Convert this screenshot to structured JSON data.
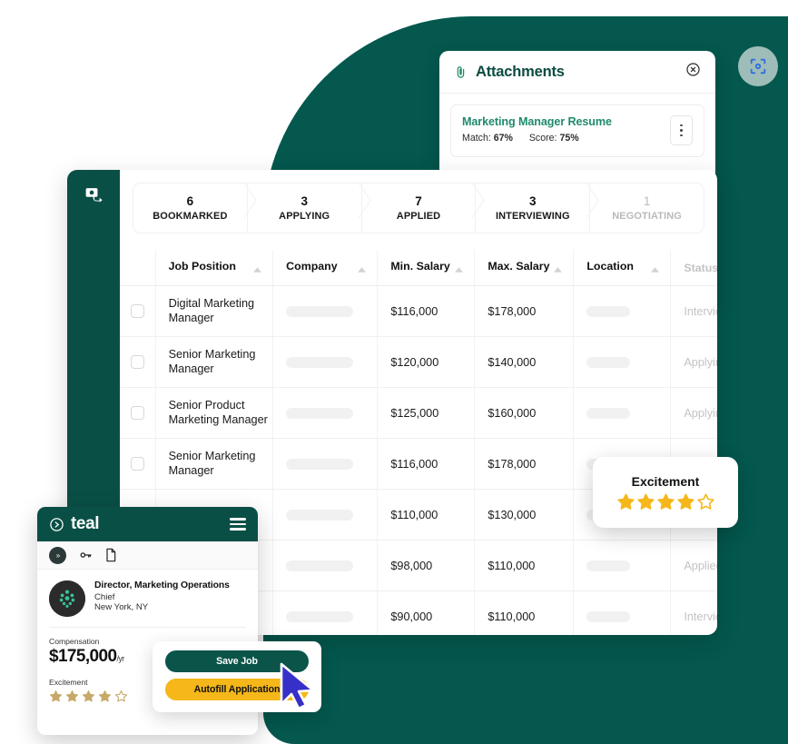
{
  "colors": {
    "teal_bg": "#04584e",
    "teal_dark": "#0a4f45",
    "brand_green": "#1f8a6d",
    "gold": "#f5b719",
    "cursor_blue": "#3730c8",
    "muted": "#c3c3c3"
  },
  "scan_button": {
    "icon": "scan-capture-icon"
  },
  "attachments": {
    "icon": "paperclip-icon",
    "title": "Attachments",
    "close_icon": "close-circle-icon",
    "items": [
      {
        "name": "Marketing Manager Resume",
        "match_label": "Match:",
        "match_value": "67%",
        "score_label": "Score:",
        "score_value": "75%",
        "menu_icon": "kebab-menu-icon"
      }
    ]
  },
  "tracker": {
    "logo_icon": "teal-logo-mark",
    "pipeline": [
      {
        "count": "6",
        "label": "BOOKMARKED",
        "muted": false
      },
      {
        "count": "3",
        "label": "APPLYING",
        "muted": false
      },
      {
        "count": "7",
        "label": "APPLIED",
        "muted": false
      },
      {
        "count": "3",
        "label": "INTERVIEWING",
        "muted": false
      },
      {
        "count": "1",
        "label": "NEGOTIATING",
        "muted": true
      }
    ],
    "columns": [
      {
        "label": "Job Position",
        "sortable": true,
        "muted": false
      },
      {
        "label": "Company",
        "sortable": true,
        "muted": false
      },
      {
        "label": "Min. Salary",
        "sortable": true,
        "muted": false
      },
      {
        "label": "Max. Salary",
        "sortable": true,
        "muted": false
      },
      {
        "label": "Location",
        "sortable": true,
        "muted": false
      },
      {
        "label": "Status",
        "sortable": false,
        "muted": true
      }
    ],
    "rows": [
      {
        "job": "Digital Marketing Manager",
        "company": "",
        "min": "$116,000",
        "max": "$178,000",
        "location": "",
        "status": "Intervie"
      },
      {
        "job": "Senior Marketing Manager",
        "company": "",
        "min": "$120,000",
        "max": "$140,000",
        "location": "",
        "status": "Applyin"
      },
      {
        "job": "Senior Product Marketing Manager",
        "company": "",
        "min": "$125,000",
        "max": "$160,000",
        "location": "",
        "status": "Applyin"
      },
      {
        "job": "Senior Marketing Manager",
        "company": "",
        "min": "$116,000",
        "max": "$178,000",
        "location": "",
        "status": ""
      },
      {
        "job": "",
        "company": "",
        "min": "$110,000",
        "max": "$130,000",
        "location": "",
        "status": ""
      },
      {
        "job": "",
        "company": "",
        "min": "$98,000",
        "max": "$110,000",
        "location": "",
        "status": "Applied"
      },
      {
        "job": "",
        "company": "",
        "min": "$90,000",
        "max": "$110,000",
        "location": "",
        "status": "Intervie"
      }
    ]
  },
  "excitement_popover": {
    "label": "Excitement",
    "rating": 4,
    "max": 5
  },
  "extension": {
    "brand": "teal",
    "logo_icon": "teal-play-circle-icon",
    "menu_icon": "hamburger-icon",
    "tools": [
      "chevrons-icon",
      "key-icon",
      "document-icon"
    ],
    "job": {
      "title": "Director, Marketing Operations",
      "company": "Chief",
      "location": "New York, NY"
    },
    "compensation_label": "Compensation",
    "compensation_value": "$175,000",
    "compensation_unit": "/yr",
    "excitement_label": "Excitement",
    "excitement_rating": 4,
    "excitement_max": 5,
    "buttons": {
      "save": "Save Job",
      "autofill": "Autofill Application"
    }
  }
}
